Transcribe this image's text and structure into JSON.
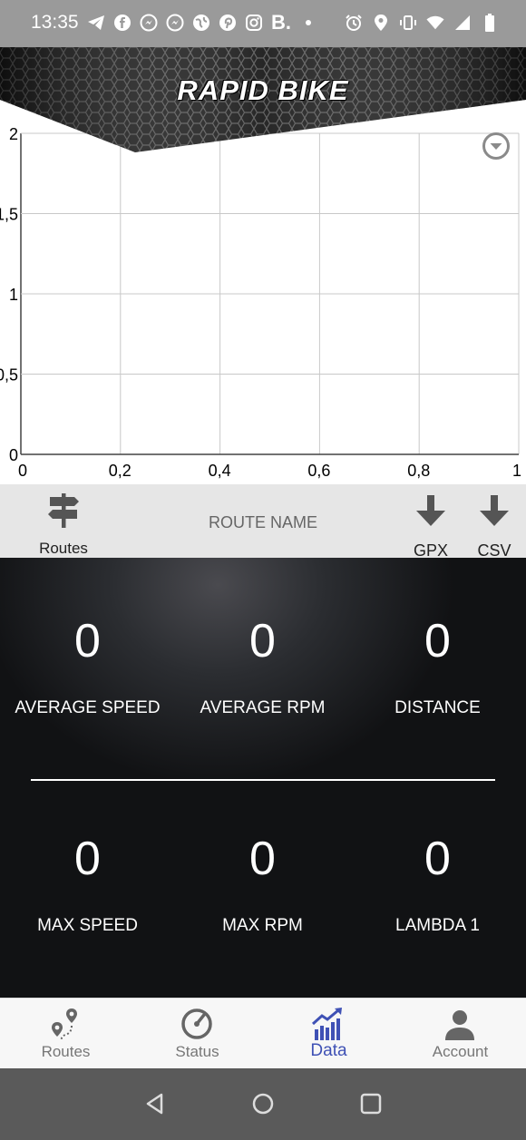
{
  "status_bar": {
    "time": "13:35",
    "left_icons": [
      "telegram-icon",
      "facebook-icon",
      "messenger-icon",
      "messenger-icon",
      "globe-icon",
      "pinterest-icon",
      "instagram-icon"
    ],
    "b_label": "B.",
    "right_icons": [
      "alarm-icon",
      "location-icon",
      "vibrate-icon",
      "wifi-icon",
      "signal-icon",
      "battery-icon"
    ]
  },
  "header": {
    "title": "RAPID BIKE"
  },
  "chart_data": {
    "type": "line",
    "x": [],
    "series": [],
    "xlim": [
      0,
      1
    ],
    "ylim": [
      0,
      2
    ],
    "x_ticks": [
      "0",
      "0,2",
      "0,4",
      "0,6",
      "0,8",
      "1"
    ],
    "y_ticks": [
      "0",
      "0,5",
      "1",
      "1,5",
      "2"
    ],
    "grid": true
  },
  "route_bar": {
    "routes_label": "Routes",
    "route_name": "ROUTE NAME",
    "gpx_label": "GPX",
    "csv_label": "CSV"
  },
  "stats": {
    "average_speed": {
      "value": "0",
      "label": "AVERAGE SPEED"
    },
    "average_rpm": {
      "value": "0",
      "label": "AVERAGE RPM"
    },
    "distance": {
      "value": "0",
      "label": "DISTANCE"
    },
    "max_speed": {
      "value": "0",
      "label": "MAX SPEED"
    },
    "max_rpm": {
      "value": "0",
      "label": "MAX RPM"
    },
    "lambda_1": {
      "value": "0",
      "label": "LAMBDA 1"
    }
  },
  "bottom_nav": {
    "items": [
      {
        "label": "Routes",
        "icon": "route-pin-icon"
      },
      {
        "label": "Status",
        "icon": "speedometer-icon"
      },
      {
        "label": "Data",
        "icon": "chart-icon"
      },
      {
        "label": "Account",
        "icon": "person-icon"
      }
    ],
    "active": "Data"
  },
  "colors": {
    "accent": "#3f51b5",
    "statusbar": "#9a9a9a",
    "routebar": "#e6e6e6",
    "navbar": "#5a5a5a"
  }
}
